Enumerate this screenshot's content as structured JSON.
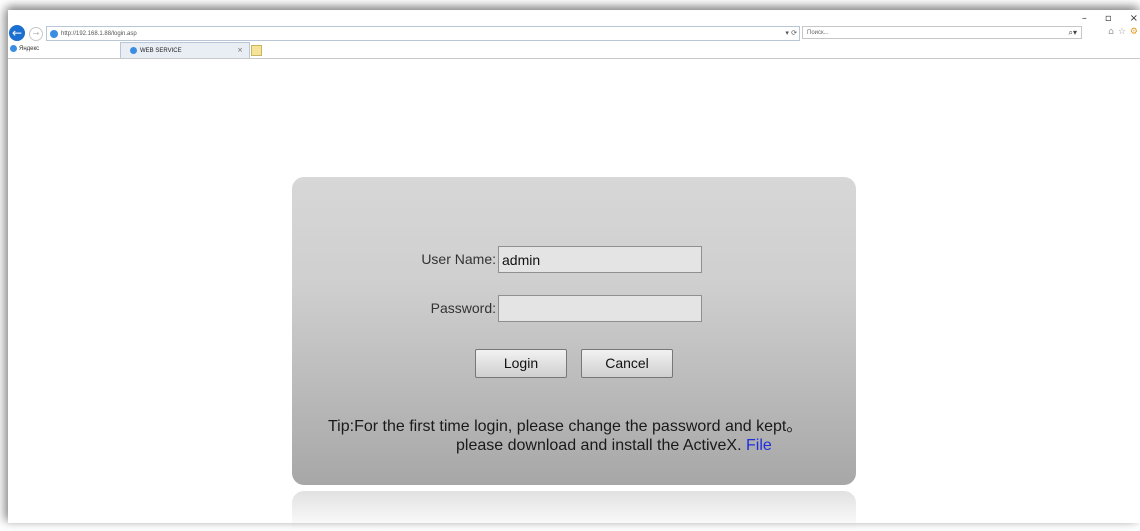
{
  "browser": {
    "address_url": "http://192.168.1.88/login.asp",
    "search_placeholder": "Поиск...",
    "favorites_item": "Яндекс",
    "tab_title": "WEB SERVICE"
  },
  "window_controls": {
    "minimize": "–",
    "restore": "▫",
    "close": "×"
  },
  "login": {
    "username_label": "User Name:",
    "username_value": "admin",
    "password_label": "Password:",
    "password_value": "",
    "login_button": "Login",
    "cancel_button": "Cancel",
    "tip_line1": "Tip:For the first time login, please change the password and kept。",
    "tip_line2": "please download and install the ActiveX.",
    "file_link": "File"
  },
  "colors": {
    "link": "#1f2de0",
    "back_button": "#1a6fd0"
  },
  "icons": [
    "back-arrow-icon",
    "forward-arrow-icon",
    "ie-page-icon",
    "refresh-icon",
    "search-icon",
    "home-icon",
    "favorites-star-icon",
    "settings-icon"
  ]
}
